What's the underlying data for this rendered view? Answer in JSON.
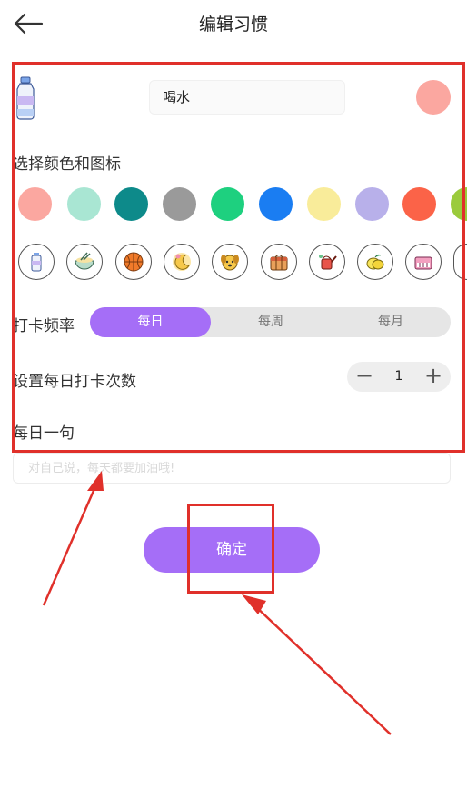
{
  "header": {
    "title": "编辑习惯",
    "back_icon": "arrow-left-icon"
  },
  "habit": {
    "name": "喝水",
    "icon": "water-bottle-icon",
    "selected_color": "#fba7a0"
  },
  "color_section": {
    "label": "选择颜色和图标"
  },
  "colors": [
    "#fba7a0",
    "#a9e6d3",
    "#0d8a8a",
    "#9a9a9a",
    "#1ed07f",
    "#1a7df2",
    "#f9ec9a",
    "#b8b0ea",
    "#fb6348",
    "#9bcb3c"
  ],
  "icons": [
    "water-bottle-icon",
    "noodle-bowl-icon",
    "basketball-icon",
    "moon-sleep-icon",
    "dog-icon",
    "gift-box-icon",
    "watering-can-icon",
    "lemon-icon",
    "piano-icon",
    "partial-icon"
  ],
  "frequency": {
    "label": "打卡频率",
    "options": [
      "每日",
      "每周",
      "每月"
    ],
    "selected": "每日"
  },
  "daily_count": {
    "label": "设置每日打卡次数",
    "value": "1",
    "minus": "−",
    "plus": "+"
  },
  "quote": {
    "label": "每日一句",
    "placeholder": "对自己说，每天都要加油哦!"
  },
  "confirm": {
    "label": "确定"
  },
  "theme": {
    "accent": "#a56ef7",
    "annotation": "#e0302a"
  }
}
